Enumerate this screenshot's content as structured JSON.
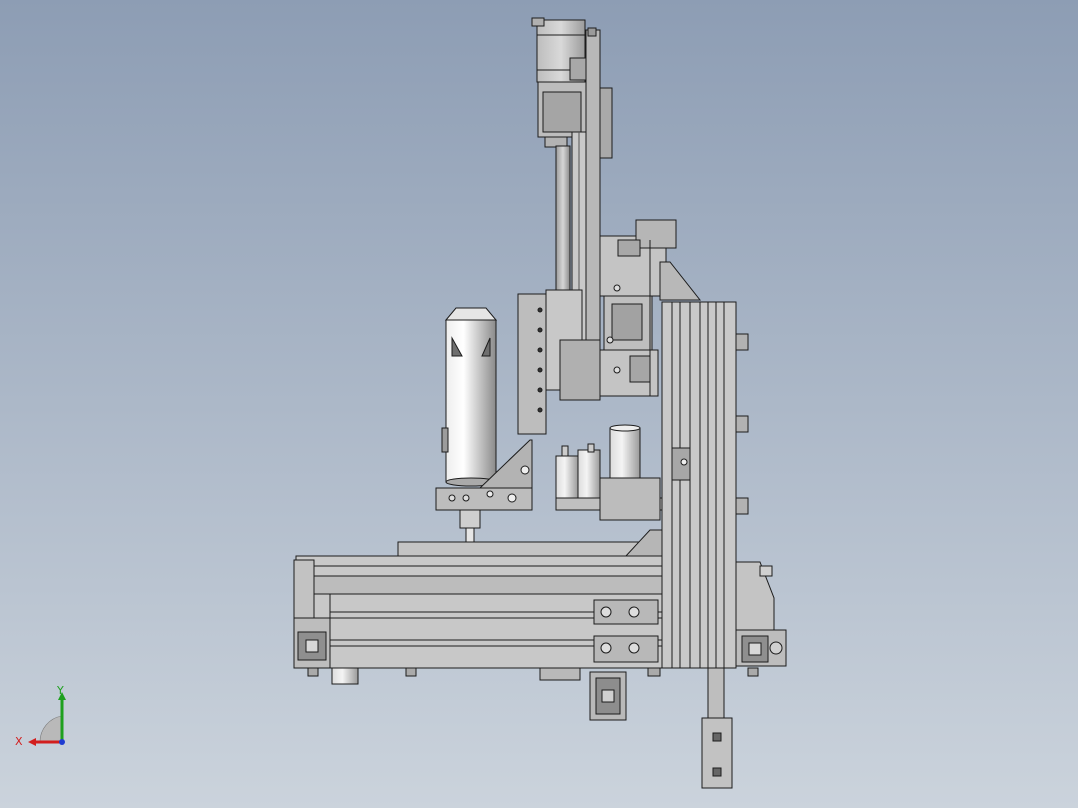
{
  "viewport": {
    "background_top": "#8d9db4",
    "background_bottom": "#cbd3dc"
  },
  "model": {
    "part_fill": "#c2c2c2",
    "part_fill_light": "#d8d8d8",
    "part_fill_dark": "#8e8e8e",
    "edge_color": "#1c1c1c"
  },
  "triad": {
    "x_label": "X",
    "y_label": "Y",
    "x_color": "#d21e1e",
    "y_color": "#1ea01e",
    "z_color": "#1e3cd2"
  }
}
